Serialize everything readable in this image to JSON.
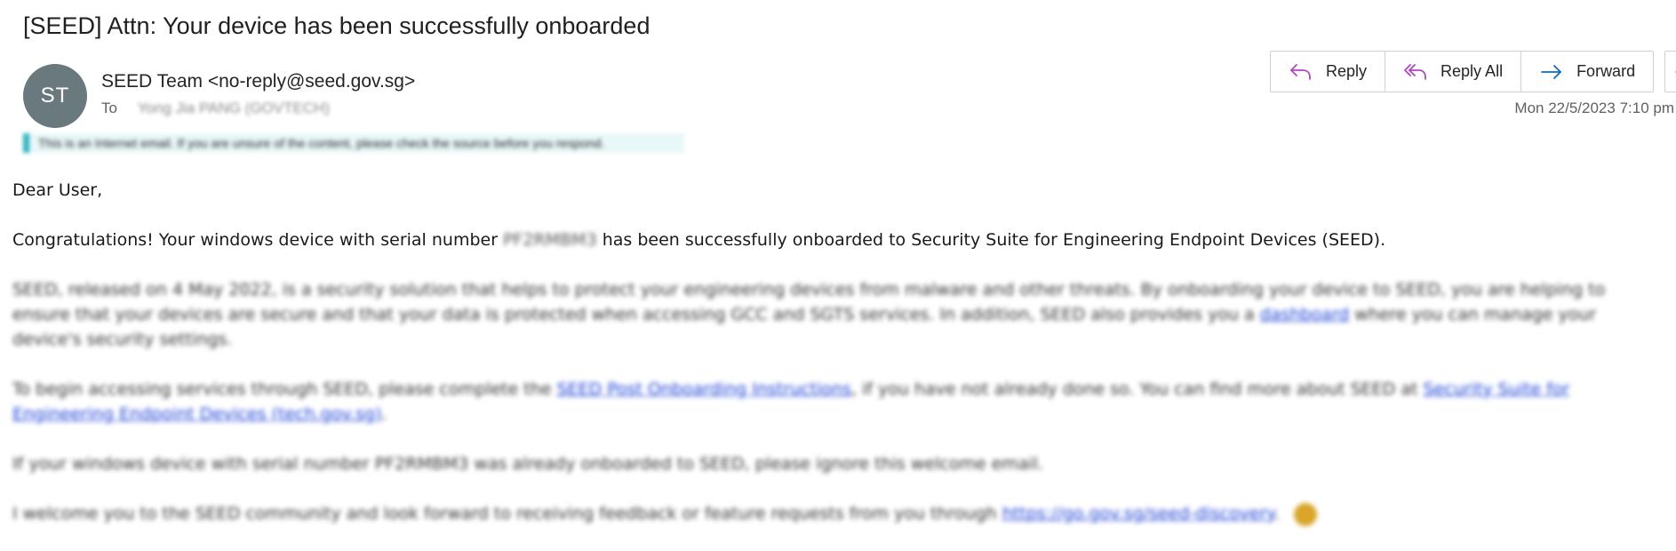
{
  "email": {
    "subject": "[SEED] Attn: Your device has been successfully onboarded",
    "sender_initials": "ST",
    "sender": "SEED Team <no-reply@seed.gov.sg>",
    "to_label": "To",
    "recipient": "Yong Jia PANG (GOVTECH)",
    "external_banner": "This is an Internet email. If you are unsure of the content, please check the source before you respond.",
    "timestamp": "Mon 22/5/2023 7:10 pm"
  },
  "actions": {
    "reply": "Reply",
    "reply_all": "Reply All",
    "forward": "Forward",
    "more": "…"
  },
  "icons": {
    "reply": "reply-icon",
    "reply_all": "reply-all-icon",
    "forward": "forward-icon",
    "more": "more-icon",
    "emoji": "smile-emoji-icon"
  },
  "colors": {
    "avatar_bg": "#69797e",
    "reply_icon": "#b146c2",
    "forward_icon": "#0f6cbd",
    "link": "#1a3fd6",
    "banner_accent": "#2bb3c0"
  },
  "body": {
    "greeting": "Dear User,",
    "p1_start": "Congratulations! Your windows device with serial number",
    "serial": "PF2RMBM3",
    "p1_end": "has been successfully onboarded to Security Suite for Engineering Endpoint Devices (SEED).",
    "p2_start": "SEED, released on 4 May 2022, is a security solution that helps to protect your engineering devices from malware and other threats. By onboarding your device to SEED, you are helping to ensure that your devices are secure and that your data is protected when accessing GCC and SGTS services. In addition, SEED also provides you a",
    "p2_link": "dashboard",
    "p2_end": "where you can manage your device's security settings.",
    "p3_start": "To begin accessing services through SEED, please complete the",
    "p3_link1": "SEED Post Onboarding Instructions",
    "p3_mid": ", if you have not already done so. You can find more about SEED at",
    "p3_link2": "Security Suite for Engineering Endpoint Devices (tech.gov.sg)",
    "p3_end": ".",
    "p4_start": "If your windows device with serial number",
    "p4_serial": "PF2RMBM3",
    "p4_end": "was already onboarded to SEED, please ignore this welcome email.",
    "p5_start": "I welcome you to the SEED community and look forward to receiving feedback or feature requests from you through",
    "p5_link": "https://go.gov.sg/seed-discovery",
    "p5_end": "."
  }
}
